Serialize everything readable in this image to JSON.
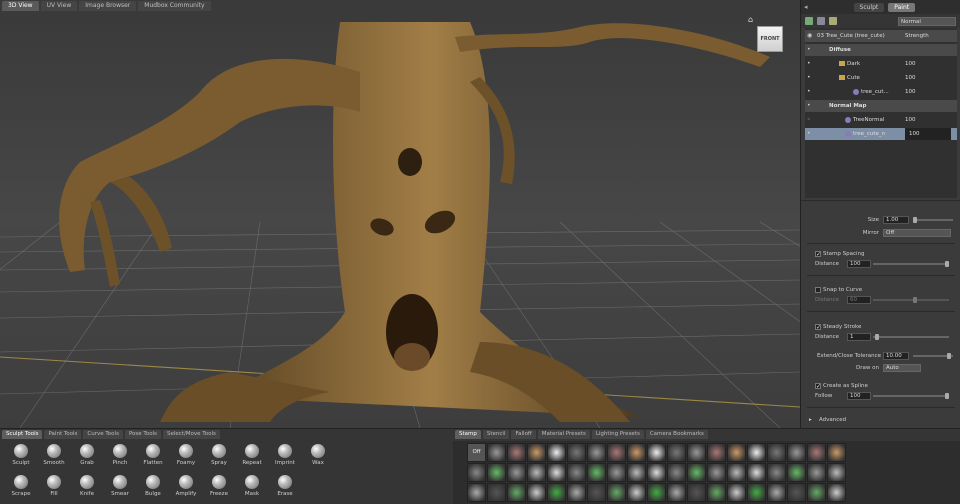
{
  "viewport_tabs": [
    "3D View",
    "UV View",
    "Image Browser",
    "Mudbox Community"
  ],
  "view_cube_label": "FRONT",
  "right_panel": {
    "tabs": [
      "Sculpt",
      "Paint"
    ],
    "blend_mode": "Normal",
    "layers": [
      {
        "name": "03 Tree_Cute (tree_cute)",
        "value": "Strength",
        "kind": "header"
      },
      {
        "name": "Diffuse",
        "value": "",
        "kind": "group"
      },
      {
        "name": "Dark",
        "value": "100",
        "kind": "folder"
      },
      {
        "name": "Cute",
        "value": "100",
        "kind": "folder"
      },
      {
        "name": "tree_cut...",
        "value": "100",
        "kind": "layer"
      },
      {
        "name": "Normal Map",
        "value": "",
        "kind": "group"
      },
      {
        "name": "TreeNormal",
        "value": "100",
        "kind": "disabled"
      },
      {
        "name": "tree_cute_n",
        "value": "100",
        "kind": "selected"
      }
    ]
  },
  "properties": {
    "size_label": "Size",
    "size_value": "1.00",
    "mirror_label": "Mirror",
    "mirror_value": "Off",
    "stamp_spacing_label": "Stamp Spacing",
    "distance_label": "Distance",
    "distance_value": "100",
    "snap_to_curve_label": "Snap to Curve",
    "snap_distance_label": "Distance",
    "snap_distance_value": "60",
    "steady_stroke_label": "Steady Stroke",
    "steady_distance_label": "Distance",
    "steady_distance_value": "1",
    "extend_label": "Extend/Close Tolerance",
    "extend_value": "10.00",
    "draw_on_label": "Draw on",
    "draw_on_value": "Auto",
    "create_spline_label": "Create as Spline",
    "follow_label": "Follow",
    "follow_value": "100",
    "advanced_label": "Advanced"
  },
  "bottom_left_tabs": [
    "Sculpt Tools",
    "Paint Tools",
    "Curve Tools",
    "Pose Tools",
    "Select/Move Tools"
  ],
  "tools_row1": [
    "Sculpt",
    "Smooth",
    "Grab",
    "Pinch",
    "Flatten",
    "Foamy",
    "Spray",
    "Repeat",
    "Imprint",
    "Wax"
  ],
  "tools_row2": [
    "Scrape",
    "Fill",
    "Knife",
    "Smear",
    "Bulge",
    "Amplify",
    "Freeze",
    "Mask",
    "Erase"
  ],
  "bottom_right_tabs": [
    "Stamp",
    "Stencil",
    "Falloff",
    "Material Presets",
    "Lighting Presets",
    "Camera Bookmarks"
  ],
  "stamp_off_label": "Off"
}
